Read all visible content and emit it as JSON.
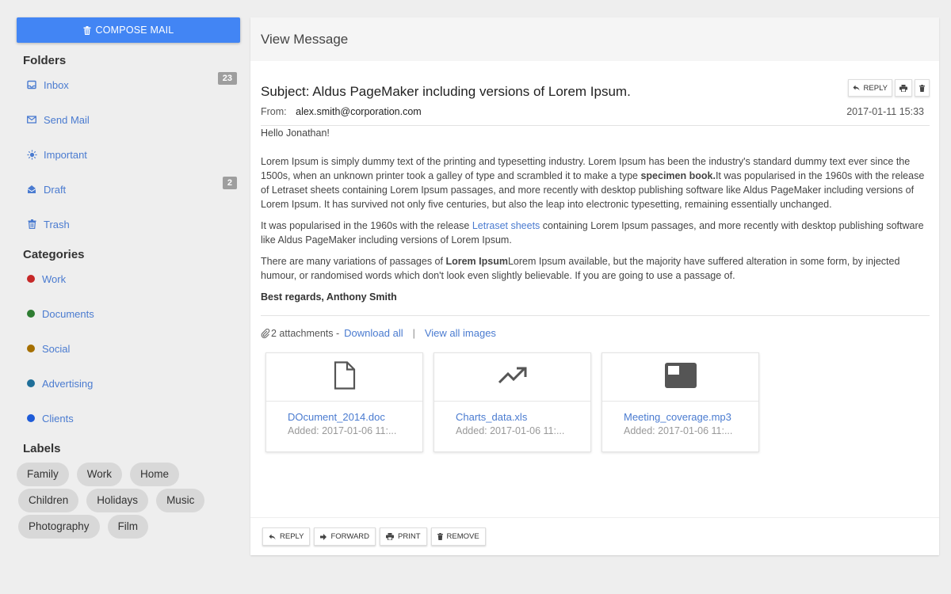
{
  "sidebar": {
    "compose_label": "COMPOSE MAIL",
    "folders_title": "Folders",
    "folders": [
      {
        "label": "Inbox",
        "icon": "inbox-icon",
        "count": "23"
      },
      {
        "label": "Send Mail",
        "icon": "mail-icon"
      },
      {
        "label": "Important",
        "icon": "sun-icon"
      },
      {
        "label": "Draft",
        "icon": "open-envelope-icon",
        "count": "2"
      },
      {
        "label": "Trash",
        "icon": "trash-icon"
      }
    ],
    "categories_title": "Categories",
    "categories": [
      {
        "label": "Work",
        "color": "#c62828"
      },
      {
        "label": "Documents",
        "color": "#2e7d32"
      },
      {
        "label": "Social",
        "color": "#a56f00"
      },
      {
        "label": "Advertising",
        "color": "#1f6f99"
      },
      {
        "label": "Clients",
        "color": "#1e5bd8"
      }
    ],
    "labels_title": "Labels",
    "labels": [
      "Family",
      "Work",
      "Home",
      "Children",
      "Holidays",
      "Music",
      "Photography",
      "Film"
    ]
  },
  "main": {
    "header_title": "View Message",
    "subject": "Subject: Aldus PageMaker including versions of Lorem Ipsum.",
    "top_actions": {
      "reply_label": "REPLY"
    },
    "from_label": "From:",
    "from_email": "alex.smith@corporation.com",
    "date": "2017-01-11 15:33",
    "greeting": "Hello Jonathan!",
    "paragraph1": {
      "text_a": "Lorem Ipsum is simply dummy text of the printing and typesetting industry. Lorem Ipsum has been the industry's standard dummy text ever since the 1500s, when an unknown printer took a galley of type and scrambled it to make a type ",
      "bold": "specimen book.",
      "text_b": "It was popularised in the 1960s with the release of Letraset sheets containing Lorem Ipsum passages, and more recently with desktop publishing software like Aldus PageMaker including versions of Lorem Ipsum. It has survived not only five centuries, but also the leap into electronic typesetting, remaining essentially unchanged."
    },
    "paragraph2": {
      "text_a": "It was popularised in the 1960s with the release ",
      "link": "Letraset sheets",
      "text_b": " containing Lorem Ipsum passages, and more recently with desktop publishing software like Aldus PageMaker including versions of Lorem Ipsum."
    },
    "paragraph3": {
      "text_a": "There are many variations of passages of ",
      "bold": "Lorem Ipsum",
      "text_b": "Lorem Ipsum available, but the majority have suffered alteration in some form, by injected humour, or randomised words which don't look even slightly believable. If you are going to use a passage of."
    },
    "signature": "Best regards, Anthony Smith",
    "attachments_count": "2 attachments -",
    "download_all": "Download all",
    "separator": "|",
    "view_all_images": "View all images",
    "attachments": [
      {
        "name": "DOcument_2014.doc",
        "added": "Added: 2017-01-06 11:...",
        "icon": "document-icon"
      },
      {
        "name": "Charts_data.xls",
        "added": "Added: 2017-01-06 11:...",
        "icon": "trending-up-icon"
      },
      {
        "name": "Meeting_coverage.mp3",
        "added": "Added: 2017-01-06 11:...",
        "icon": "media-icon"
      }
    ],
    "footer": {
      "reply_label": "REPLY",
      "forward_label": "FORWARD",
      "print_label": "PRINT",
      "remove_label": "REMOVE"
    }
  }
}
